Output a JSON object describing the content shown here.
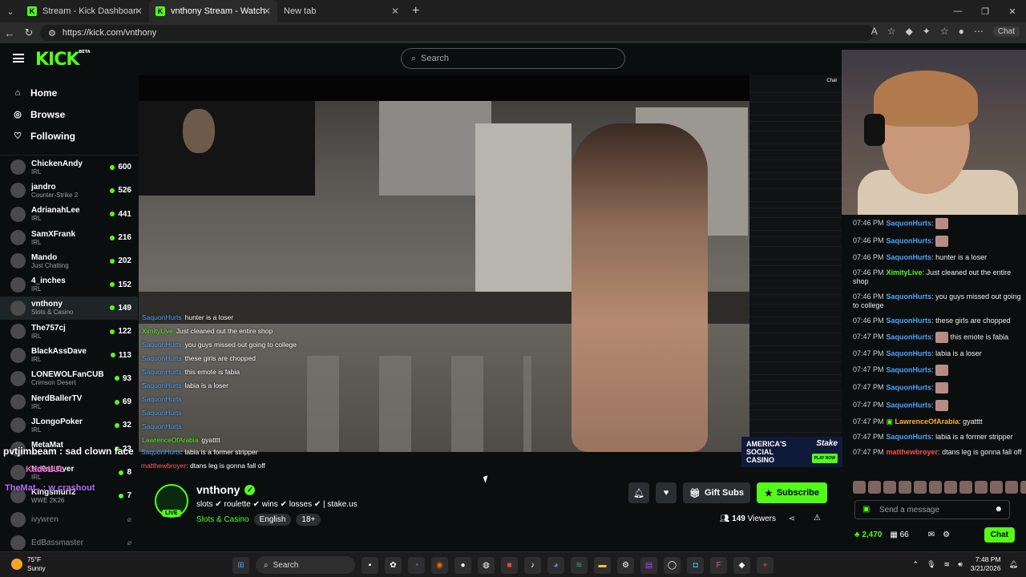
{
  "browser": {
    "tabs": [
      {
        "title": "Stream - Kick Dashboard",
        "active": false
      },
      {
        "title": "vnthony Stream - Watch Live on Kick",
        "active": true
      },
      {
        "title": "New tab",
        "active": false
      }
    ],
    "url": "https://kick.com/vnthony",
    "chat_button": "Chat"
  },
  "header": {
    "logo": "KICK",
    "logo_beta": "BETA",
    "search_placeholder": "Search"
  },
  "sidebar": {
    "nav": [
      {
        "label": "Home",
        "icon": "home-icon"
      },
      {
        "label": "Browse",
        "icon": "compass-icon"
      },
      {
        "label": "Following",
        "icon": "heart-icon"
      }
    ],
    "channels": [
      {
        "name": "ChickenAndy",
        "category": "IRL",
        "viewers": "600"
      },
      {
        "name": "jandro",
        "category": "Counter-Strike 2",
        "viewers": "526"
      },
      {
        "name": "AdrianahLee",
        "category": "IRL",
        "viewers": "441"
      },
      {
        "name": "SamXFrank",
        "category": "IRL",
        "viewers": "216"
      },
      {
        "name": "Mando",
        "category": "Just Chatting",
        "viewers": "202"
      },
      {
        "name": "4_inches",
        "category": "IRL",
        "viewers": "152"
      },
      {
        "name": "vnthony",
        "category": "Slots & Casino",
        "viewers": "149"
      },
      {
        "name": "The757cj",
        "category": "IRL",
        "viewers": "122"
      },
      {
        "name": "BlackAssDave",
        "category": "IRL",
        "viewers": "113"
      },
      {
        "name": "LONEWOLFanCUB",
        "category": "Crimson Desert",
        "viewers": "93"
      },
      {
        "name": "NerdBallerTV",
        "category": "IRL",
        "viewers": "69"
      },
      {
        "name": "JLongoPoker",
        "category": "IRL",
        "viewers": "32"
      },
      {
        "name": "MetaMat",
        "category": "IRL",
        "viewers": "23"
      },
      {
        "name": "Ne0nLOver",
        "category": "IRL",
        "viewers": "8"
      },
      {
        "name": "Kingsmurf2",
        "category": "WWE 2K26",
        "viewers": "7"
      },
      {
        "name": "ivywren",
        "category": "",
        "viewers": ""
      },
      {
        "name": "EdBassmaster",
        "category": "",
        "viewers": ""
      }
    ]
  },
  "video_overlay": {
    "chat": [
      {
        "user": "SaquonHurts",
        "text": "hunter is a loser"
      },
      {
        "user": "XimityLive",
        "text": "Just cleaned out the entire shop"
      },
      {
        "user": "SaquonHurts",
        "text": "you guys missed out going to college"
      },
      {
        "user": "SaquonHurts",
        "text": "these girls are chopped"
      },
      {
        "user": "SaquonHurts",
        "text": "this emote is fabia"
      },
      {
        "user": "SaquonHurts",
        "text": "labia is a loser"
      },
      {
        "user": "SaquonHurts",
        "text": ""
      },
      {
        "user": "SaquonHurts",
        "text": ""
      },
      {
        "user": "SaquonHurts",
        "text": ""
      },
      {
        "user": "LawrenceOfArabia",
        "text": "gyatttt"
      }
    ],
    "below": [
      {
        "user": "SaquonHurts",
        "text": ": labia is a former stripper"
      },
      {
        "user": "matthewbroyer",
        "text": ": dtans leg is gonna fall off"
      }
    ],
    "pvt": "pvtjimbeam : sad clown face",
    "kado": "KadoLUL",
    "themat": "TheMat...: w crashout",
    "embed_chat_header": "Chat",
    "ad_text": "AMERICA'S SOCIAL CASINO",
    "ad_brand": "Stake",
    "ad_cta": "PLAY NOW"
  },
  "stream": {
    "name": "vnthony",
    "live": "LIVE",
    "title": "slots ✔ roulette ✔ wins ✔ losses ✔ | stake.us",
    "category": "Slots & Casino",
    "tags": [
      "English",
      "18+"
    ],
    "gift_subs": "Gift Subs",
    "subscribe": "Subscribe",
    "viewers": "149",
    "viewers_label": "Viewers"
  },
  "chat": {
    "messages": [
      {
        "time": "07:46 PM",
        "user": "SaquonHurts",
        "text": "",
        "emote": true,
        "color": "blue"
      },
      {
        "time": "07:46 PM",
        "user": "SaquonHurts",
        "text": "",
        "emote": true,
        "color": "blue"
      },
      {
        "time": "07:46 PM",
        "user": "SaquonHurts",
        "text": "hunter is a loser",
        "color": "blue"
      },
      {
        "time": "07:46 PM",
        "user": "XimityLive",
        "text": "Just cleaned out the entire shop",
        "color": "green"
      },
      {
        "time": "07:46 PM",
        "user": "SaquonHurts",
        "text": "you guys missed out going to college",
        "color": "blue"
      },
      {
        "time": "07:46 PM",
        "user": "SaquonHurts",
        "text": "these girls are chopped",
        "color": "blue"
      },
      {
        "time": "07:47 PM",
        "user": "SaquonHurts",
        "text": "this emote is fabia",
        "emote": true,
        "color": "blue"
      },
      {
        "time": "07:47 PM",
        "user": "SaquonHurts",
        "text": "labia is a loser",
        "color": "blue"
      },
      {
        "time": "07:47 PM",
        "user": "SaquonHurts",
        "text": "",
        "emote": true,
        "color": "blue"
      },
      {
        "time": "07:47 PM",
        "user": "SaquonHurts",
        "text": "",
        "emote": true,
        "color": "blue"
      },
      {
        "time": "07:47 PM",
        "user": "SaquonHurts",
        "text": "",
        "emote": true,
        "color": "blue"
      },
      {
        "time": "07:47 PM",
        "user": "LawrenceOfArabia",
        "text": "gyatttt",
        "color": "orange"
      },
      {
        "time": "07:47 PM",
        "user": "SaquonHurts",
        "text": "labia is a former stripper",
        "color": "blue"
      },
      {
        "time": "07:47 PM",
        "user": "matthewbroyer",
        "text": "dtans leg is gonna fall off",
        "color": "red"
      }
    ],
    "input_placeholder": "Send a message",
    "points": "2,470",
    "subs_count": "66",
    "send_label": "Chat"
  },
  "taskbar": {
    "temp": "75°F",
    "weather": "Sunny",
    "search": "Search",
    "time": "7:48 PM",
    "date": "3/21/2026"
  },
  "colors": {
    "accent": "#53fc18",
    "background": "#0b0e0f",
    "username_blue": "#4da3ff"
  }
}
